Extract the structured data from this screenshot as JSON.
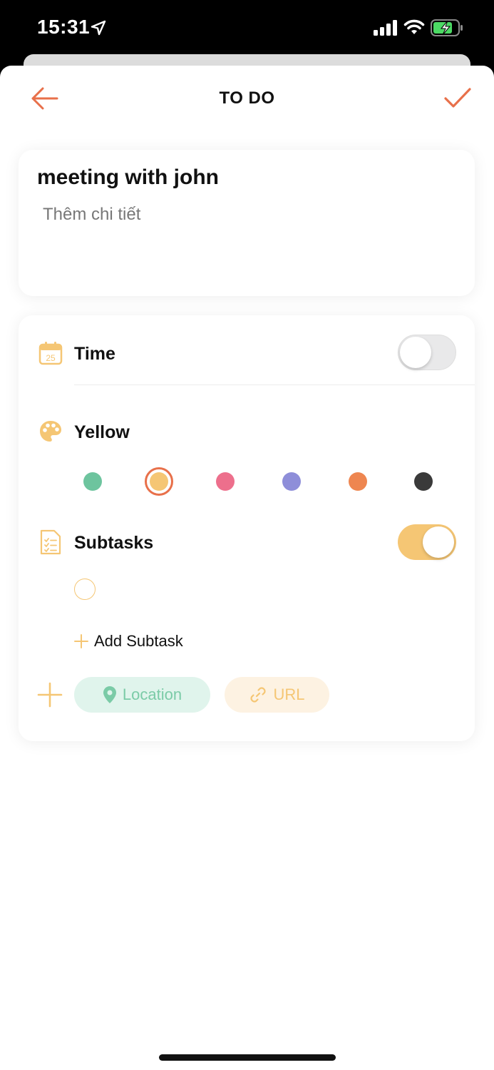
{
  "status_bar": {
    "time": "15:31"
  },
  "header": {
    "title": "TO DO"
  },
  "task": {
    "title": "meeting with john",
    "detail_placeholder": "Thêm chi tiết"
  },
  "options": {
    "time_label": "Time",
    "time_enabled": false,
    "color_label": "Yellow",
    "colors": [
      {
        "name": "green",
        "hex": "#6dc49e"
      },
      {
        "name": "yellow",
        "hex": "#f5c674",
        "selected": true
      },
      {
        "name": "pink",
        "hex": "#ed6f8c"
      },
      {
        "name": "purple",
        "hex": "#8e8ed9"
      },
      {
        "name": "orange",
        "hex": "#ee8650"
      },
      {
        "name": "dark",
        "hex": "#3a3a3a"
      }
    ],
    "subtasks_label": "Subtasks",
    "subtasks_enabled": true,
    "add_subtask_label": "Add Subtask",
    "location_label": "Location",
    "url_label": "URL"
  },
  "theme": {
    "accent": "#e8704a",
    "yellow": "#f5c674",
    "green": "#7bcba7"
  },
  "icons": [
    "location-arrow-icon",
    "cellular-signal-icon",
    "wifi-icon",
    "battery-charging-icon",
    "back-arrow-icon",
    "checkmark-icon",
    "calendar-icon",
    "palette-icon",
    "checklist-icon",
    "plus-icon",
    "map-pin-icon",
    "link-icon"
  ]
}
